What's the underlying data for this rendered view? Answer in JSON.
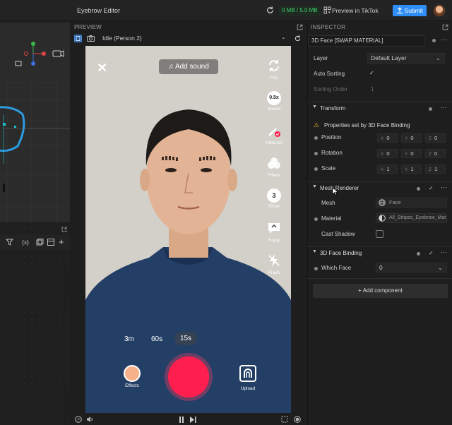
{
  "app": {
    "title": "Eyebrow Editor"
  },
  "topbar": {
    "storage": "0 MB / 5.0 MB",
    "preview_tiktok": "Preview in TikTok",
    "submit": "Submit"
  },
  "left_toolbar": {
    "var_label": "{x}"
  },
  "preview": {
    "label": "PREVIEW",
    "person": "Idle (Person 2)",
    "add_sound": "Add sound",
    "side": [
      "Flip",
      "Speed",
      "Retouch",
      "Filters",
      "Timer",
      "Reply",
      "Flash"
    ],
    "speed_badge": "0.5x",
    "timer_badge": "3",
    "durations": [
      "3m",
      "60s",
      "15s"
    ],
    "effects": "Effects",
    "upload": "Upload"
  },
  "inspector": {
    "label": "INSPECTOR",
    "object_name": "3D Face [SWAP MATERIAL]",
    "layer_label": "Layer",
    "layer_value": "Default Layer",
    "auto_sorting": "Auto Sorting",
    "sorting_order": "Sorting Order",
    "sorting_value": "1",
    "transform": {
      "title": "Transform",
      "warning": "Properties set by 3D Face Binding",
      "position": {
        "label": "Position",
        "x": "0",
        "y": "0",
        "z": "0"
      },
      "rotation": {
        "label": "Rotation",
        "x": "0",
        "y": "0",
        "z": "0"
      },
      "scale": {
        "label": "Scale",
        "x": "1",
        "y": "1",
        "z": "1"
      }
    },
    "mesh_renderer": {
      "title": "Mesh Renderer",
      "mesh_label": "Mesh",
      "mesh_value": "Face",
      "material_label": "Material",
      "material_value": "All_Stripes_Eyebrow_Mat",
      "cast_shadow": "Cast Shadow"
    },
    "face_binding": {
      "title": "3D Face Binding",
      "which_face": "Which Face",
      "which_face_value": "0"
    },
    "add_component": "+ Add component"
  },
  "colors": {
    "accent": "#2f8ef5",
    "record": "#ff1f4e",
    "storage": "#3fcf6a"
  }
}
